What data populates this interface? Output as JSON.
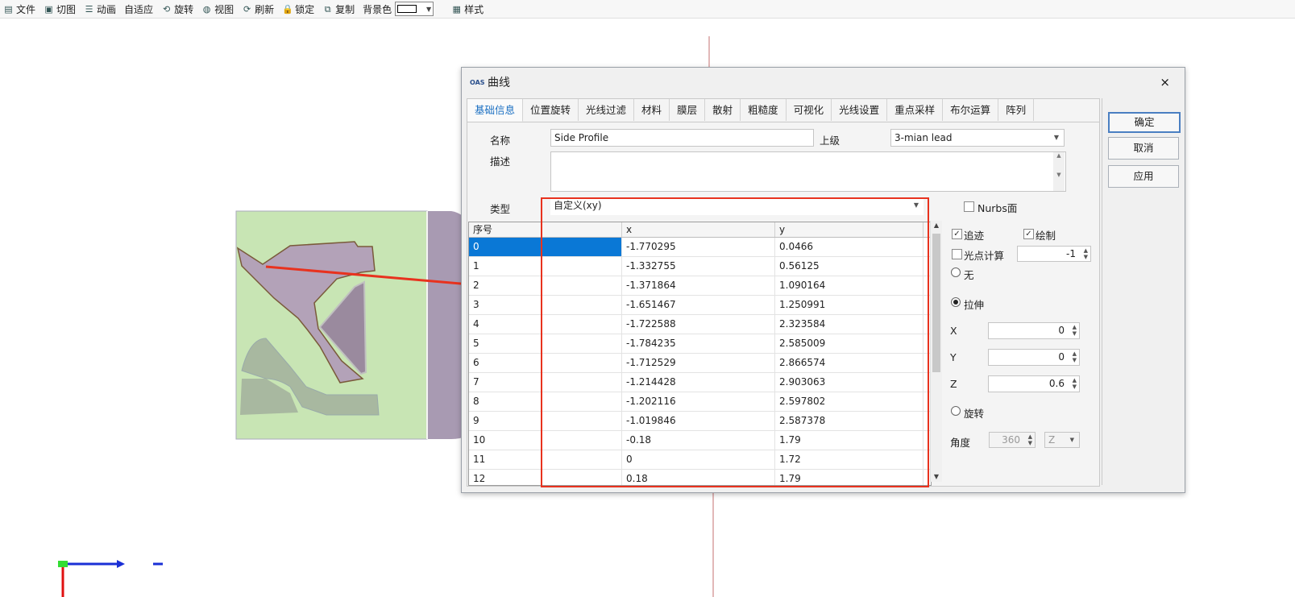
{
  "toolbar": {
    "items": [
      {
        "label": "文件",
        "icon": "file-icon",
        "glyph": "▤"
      },
      {
        "label": "切图",
        "icon": "cut-view-icon",
        "glyph": "▣"
      },
      {
        "label": "动画",
        "icon": "animation-icon",
        "glyph": "☰"
      },
      {
        "label": "自适应",
        "icon": "",
        "glyph": ""
      },
      {
        "label": "旋转",
        "icon": "rotate-icon",
        "glyph": "⟲"
      },
      {
        "label": "视图",
        "icon": "globe-icon",
        "glyph": "◍"
      },
      {
        "label": "刷新",
        "icon": "refresh-icon",
        "glyph": "⟳"
      },
      {
        "label": "锁定",
        "icon": "lock-icon",
        "glyph": "🔒"
      },
      {
        "label": "复制",
        "icon": "copy-icon",
        "glyph": "⧉"
      }
    ],
    "bg_label": "背景色",
    "style_label": "样式"
  },
  "dialog": {
    "title": "曲线",
    "logo": "OAS",
    "close": "×",
    "tabs": [
      "基础信息",
      "位置旋转",
      "光线过滤",
      "材料",
      "膜层",
      "散射",
      "粗糙度",
      "可视化",
      "光线设置",
      "重点采样",
      "布尔运算",
      "阵列"
    ],
    "active_tab": 0,
    "buttons": {
      "ok": "确定",
      "cancel": "取消",
      "apply": "应用"
    },
    "form": {
      "name_label": "名称",
      "name_value": "Side Profile",
      "parent_label": "上级",
      "parent_value": "3-mian lead",
      "desc_label": "描述",
      "desc_value": "",
      "type_label": "类型",
      "type_value": "自定义(xy)",
      "nurbs_label": "Nurbs面",
      "trace_label": "追迹",
      "draw_label": "绘制",
      "spot_label": "光点计算",
      "spot_value": "-1",
      "none_label": "无",
      "extrude_label": "拉伸",
      "x_label": "X",
      "x_value": "0",
      "y_label": "Y",
      "y_value": "0",
      "z_label": "Z",
      "z_value": "0.6",
      "revolve_label": "旋转",
      "angle_label": "角度",
      "angle_value": "360",
      "axis_value": "Z"
    },
    "table": {
      "headers": [
        "序号",
        "x",
        "y"
      ],
      "rows": [
        [
          "0",
          "-1.770295",
          "0.0466"
        ],
        [
          "1",
          "-1.332755",
          "0.56125"
        ],
        [
          "2",
          "-1.371864",
          "1.090164"
        ],
        [
          "3",
          "-1.651467",
          "1.250991"
        ],
        [
          "4",
          "-1.722588",
          "2.323584"
        ],
        [
          "5",
          "-1.784235",
          "2.585009"
        ],
        [
          "6",
          "-1.712529",
          "2.866574"
        ],
        [
          "7",
          "-1.214428",
          "2.903063"
        ],
        [
          "8",
          "-1.202116",
          "2.597802"
        ],
        [
          "9",
          "-1.019846",
          "2.587378"
        ],
        [
          "10",
          "-0.18",
          "1.79"
        ],
        [
          "11",
          "0",
          "1.72"
        ],
        [
          "12",
          "0.18",
          "1.79"
        ]
      ]
    }
  },
  "colors": {
    "annotation": "#e8321e",
    "selected": "#0a78d6",
    "active_tab": "#1a6fc2"
  }
}
